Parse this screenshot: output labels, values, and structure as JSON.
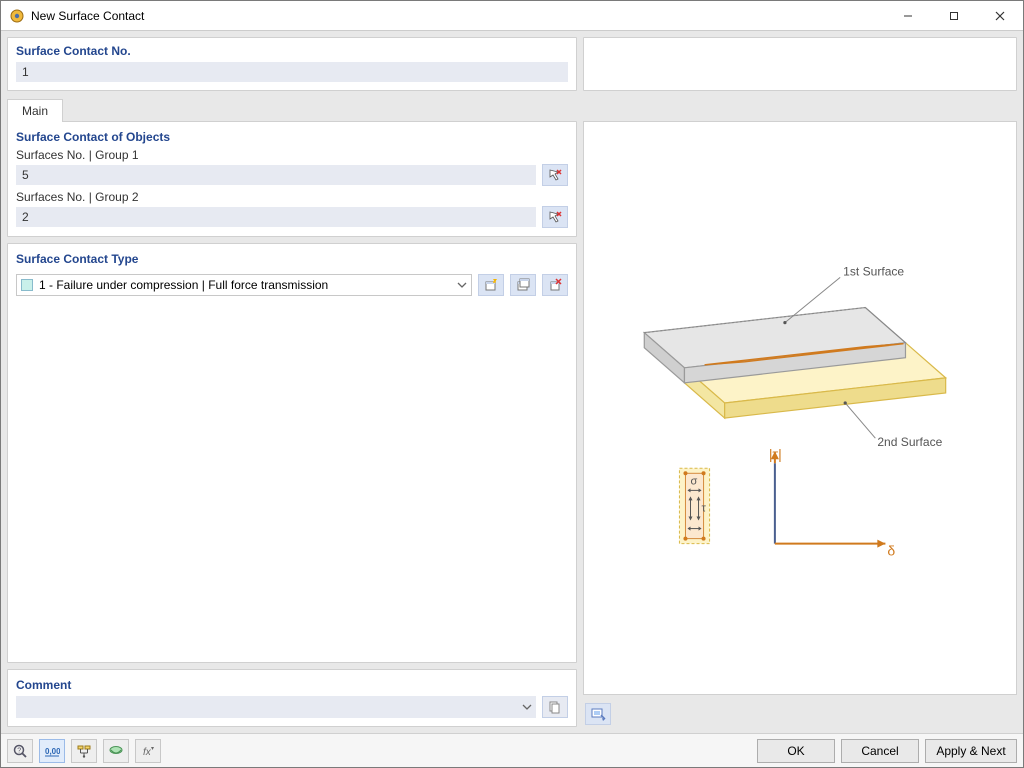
{
  "window": {
    "title": "New Surface Contact"
  },
  "number_section": {
    "label": "Surface Contact No.",
    "value": "1"
  },
  "tabs": {
    "main": "Main"
  },
  "objects_section": {
    "heading": "Surface Contact of Objects",
    "group1_label": "Surfaces No. | Group 1",
    "group1_value": "5",
    "group2_label": "Surfaces No. | Group 2",
    "group2_value": "2"
  },
  "type_section": {
    "heading": "Surface Contact Type",
    "selected": "1 - Failure under compression | Full force transmission"
  },
  "comment_section": {
    "heading": "Comment",
    "value": ""
  },
  "preview": {
    "label_surface1": "1st Surface",
    "label_surface2": "2nd Surface",
    "axis_tau": "|τ|",
    "axis_delta": "δ",
    "sigma": "σ",
    "tau": "τ"
  },
  "buttons": {
    "ok": "OK",
    "cancel": "Cancel",
    "apply_next": "Apply & Next"
  }
}
